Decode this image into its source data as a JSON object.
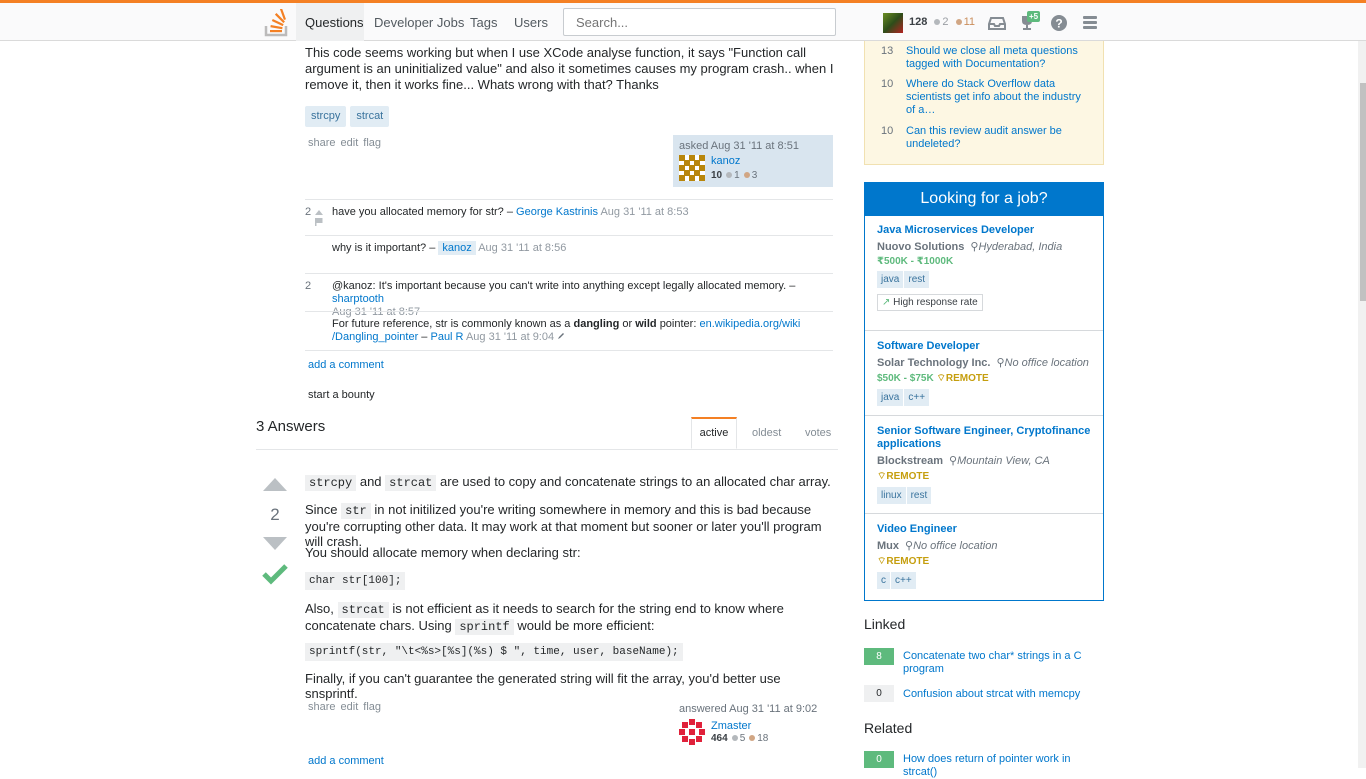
{
  "topbar": {
    "nav": [
      "Questions",
      "Developer Jobs",
      "Tags",
      "Users"
    ],
    "search_placeholder": "Search...",
    "reputation": "128",
    "silver": "2",
    "bronze": "11",
    "achievements_badge": "+5"
  },
  "question": {
    "body": "This code seems working but when I use XCode analyse function, it says \"Function call argument is an uninitialized value\" and also it sometimes causes my program crash.. when I remove it, then it works fine... Whats wrong with that? Thanks",
    "tags": [
      "strcpy",
      "strcat"
    ],
    "menu": [
      "share",
      "edit",
      "flag"
    ],
    "asked": "asked Aug 31 '11 at 8:51",
    "user": "kanoz",
    "user_rep": "10",
    "user_silver": "1",
    "user_bronze": "3"
  },
  "comments": [
    {
      "score": "2",
      "text": "have you allocated memory for str? –",
      "user": "George Kastrinis",
      "date": "Aug 31 '11 at 8:53"
    },
    {
      "score": "",
      "text": "why is it important? –",
      "user": "kanoz",
      "date": "Aug 31 '11 at 8:56"
    },
    {
      "score": "2",
      "text": "@kanoz: It's important because you can't write into anything except legally allocated memory. –",
      "user": "sharptooth",
      "date": "Aug 31 '11 at 8:57"
    },
    {
      "score": "",
      "text_a": "For future reference, str is commonly known as a",
      "bold1": "dangling",
      "text_b": "or",
      "bold2": "wild",
      "text_c": "pointer:",
      "link": "en.wikipedia.org/wiki/Dangling_pointer",
      "link_a": "en.wikipedia.org/wiki",
      "link_b": "/Dangling_pointer",
      "dash": "–",
      "user": "Paul R",
      "date": "Aug 31 '11 at 9:04"
    }
  ],
  "add_comment": "add a comment",
  "start_bounty": "start a bounty",
  "answers": {
    "count_label": "3 Answers",
    "tabs": [
      "active",
      "oldest",
      "votes"
    ]
  },
  "answer": {
    "score": "2",
    "p1_code1": "strcpy",
    "p1_mid": "and",
    "p1_code2": "strcat",
    "p1_end": "are used to copy and concatenate strings to an allocated char array.",
    "p2_start": "Since",
    "p2_code": "str",
    "p2_end": "in not initilized you're writing somewhere in memory and this is bad because you're corrupting other data. It may work at that moment but sooner or later you'll program will crash.",
    "p3": "You should allocate memory when declaring str:",
    "code1": "char str[100];",
    "p4_start": "Also,",
    "p4_code": "strcat",
    "p4_mid": "is not efficient as it needs to search for the string end to know where concatenate chars. Using",
    "p4_code2": "sprintf",
    "p4_end": "would be more efficient:",
    "code2": "sprintf(str, \"\\t<%s>[%s](%s) $ \", time, user, baseName);",
    "p5": "Finally, if you can't guarantee the generated string will fit the array, you'd better use snsprintf.",
    "menu": [
      "share",
      "edit",
      "flag"
    ],
    "answered": "answered Aug 31 '11 at 9:02",
    "user": "Zmaster",
    "user_rep": "464",
    "user_silver": "5",
    "user_bronze": "18"
  },
  "meta": [
    {
      "score": "13",
      "title": "Should we close all meta questions tagged with Documentation?"
    },
    {
      "score": "10",
      "title": "Where do Stack Overflow data scientists get info about the industry of a…"
    },
    {
      "score": "10",
      "title": "Can this review audit answer be undeleted?"
    }
  ],
  "jobs": {
    "heading": "Looking for a job?",
    "items": [
      {
        "title": "Java Microservices Developer",
        "company": "Nuovo Solutions",
        "location": "Hyderabad, India",
        "salary": "₹500K - ₹1000K",
        "remote": "",
        "tags": [
          "java",
          "rest"
        ],
        "perk": "High response rate"
      },
      {
        "title": "Software Developer",
        "company": "Solar Technology Inc.",
        "location": "No office location",
        "salary": "$50K - $75K",
        "remote": "REMOTE",
        "tags": [
          "java",
          "c++"
        ],
        "perk": ""
      },
      {
        "title": "Senior Software Engineer, Cryptofinance applications",
        "company": "Blockstream",
        "location": "Mountain View, CA",
        "salary": "",
        "remote": "REMOTE",
        "tags": [
          "linux",
          "rest"
        ],
        "perk": ""
      },
      {
        "title": "Video Engineer",
        "company": "Mux",
        "location": "No office location",
        "salary": "",
        "remote": "REMOTE",
        "tags": [
          "c",
          "c++"
        ],
        "perk": ""
      }
    ]
  },
  "linked": {
    "heading": "Linked",
    "items": [
      {
        "count": "8",
        "title": "Concatenate two char* strings in a C program"
      },
      {
        "count": "0",
        "title": "Confusion about strcat with memcpy"
      }
    ]
  },
  "related": {
    "heading": "Related",
    "items": [
      {
        "count": "0",
        "title": "How does return of pointer work in strcat()"
      }
    ]
  }
}
